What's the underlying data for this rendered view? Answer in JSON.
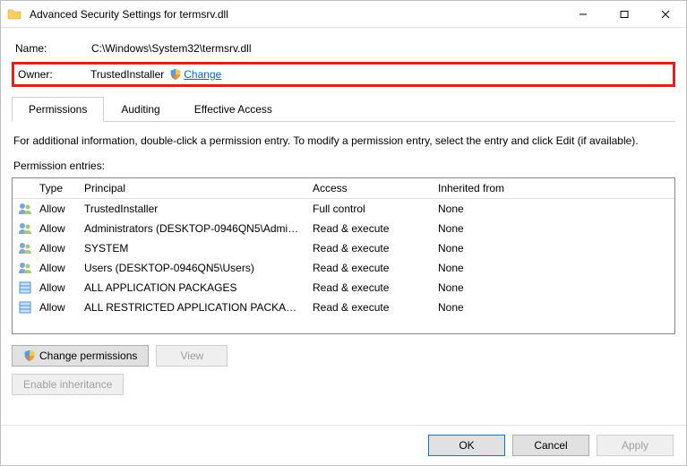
{
  "window": {
    "title": "Advanced Security Settings for termsrv.dll"
  },
  "info": {
    "name_label": "Name:",
    "name_value": "C:\\Windows\\System32\\termsrv.dll",
    "owner_label": "Owner:",
    "owner_value": "TrustedInstaller",
    "change_label": "Change"
  },
  "tabs": {
    "permissions": "Permissions",
    "auditing": "Auditing",
    "effective": "Effective Access"
  },
  "help_text": "For additional information, double-click a permission entry. To modify a permission entry, select the entry and click Edit (if available).",
  "list_label": "Permission entries:",
  "columns": {
    "type": "Type",
    "principal": "Principal",
    "access": "Access",
    "inherited": "Inherited from"
  },
  "entries": [
    {
      "icon": "users",
      "type": "Allow",
      "principal": "TrustedInstaller",
      "access": "Full control",
      "inherited": "None"
    },
    {
      "icon": "users",
      "type": "Allow",
      "principal": "Administrators (DESKTOP-0946QN5\\Admini...",
      "access": "Read & execute",
      "inherited": "None"
    },
    {
      "icon": "users",
      "type": "Allow",
      "principal": "SYSTEM",
      "access": "Read & execute",
      "inherited": "None"
    },
    {
      "icon": "users",
      "type": "Allow",
      "principal": "Users (DESKTOP-0946QN5\\Users)",
      "access": "Read & execute",
      "inherited": "None"
    },
    {
      "icon": "pkg",
      "type": "Allow",
      "principal": "ALL APPLICATION PACKAGES",
      "access": "Read & execute",
      "inherited": "None"
    },
    {
      "icon": "pkg",
      "type": "Allow",
      "principal": "ALL RESTRICTED APPLICATION PACKAGES",
      "access": "Read & execute",
      "inherited": "None"
    }
  ],
  "buttons": {
    "change_permissions": "Change permissions",
    "view": "View",
    "enable_inheritance": "Enable inheritance",
    "ok": "OK",
    "cancel": "Cancel",
    "apply": "Apply"
  }
}
